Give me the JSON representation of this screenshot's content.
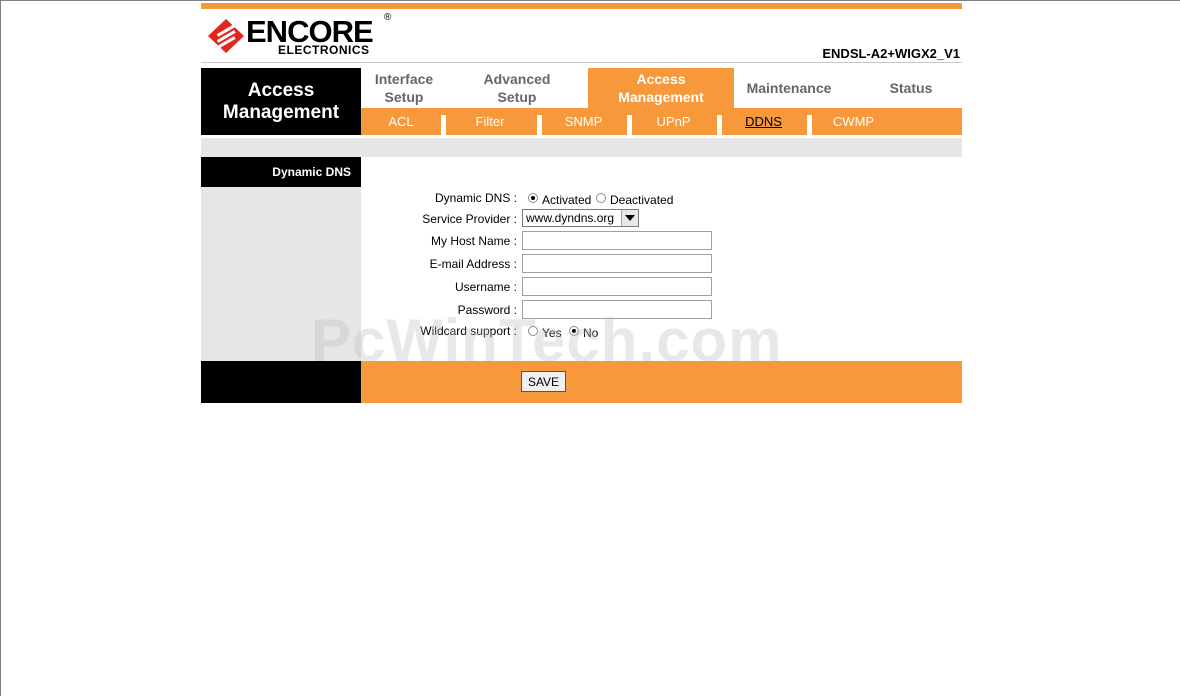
{
  "brand": {
    "name": "ENCORE",
    "sub": "ELECTRONICS",
    "mark": "®"
  },
  "model": "ENDSL-A2+WIGX2_V1",
  "section_title": "Access Management",
  "main_tabs": [
    {
      "label": "Interface Setup"
    },
    {
      "label": "Advanced Setup"
    },
    {
      "label": "Access Management"
    },
    {
      "label": "Maintenance"
    },
    {
      "label": "Status"
    }
  ],
  "sub_tabs": [
    {
      "label": "ACL"
    },
    {
      "label": "Filter"
    },
    {
      "label": "SNMP"
    },
    {
      "label": "UPnP"
    },
    {
      "label": "DDNS"
    },
    {
      "label": "CWMP"
    }
  ],
  "panel_heading": "Dynamic DNS",
  "form": {
    "dynamic_dns": {
      "label": "Dynamic DNS :",
      "option_on": "Activated",
      "option_off": "Deactivated",
      "selected": "Activated"
    },
    "service_provider": {
      "label": "Service Provider :",
      "value": "www.dyndns.org"
    },
    "host_name": {
      "label": "My Host Name :",
      "value": ""
    },
    "email": {
      "label": "E-mail Address :",
      "value": ""
    },
    "username": {
      "label": "Username :",
      "value": ""
    },
    "password": {
      "label": "Password :",
      "value": ""
    },
    "wildcard": {
      "label": "Wildcard support :",
      "option_yes": "Yes",
      "option_no": "No",
      "selected": "No"
    }
  },
  "save_label": "SAVE",
  "watermark": "PcWinTech.com",
  "colors": {
    "accent": "#f7983a",
    "dark": "#000000",
    "panel": "#e6e6e6"
  }
}
